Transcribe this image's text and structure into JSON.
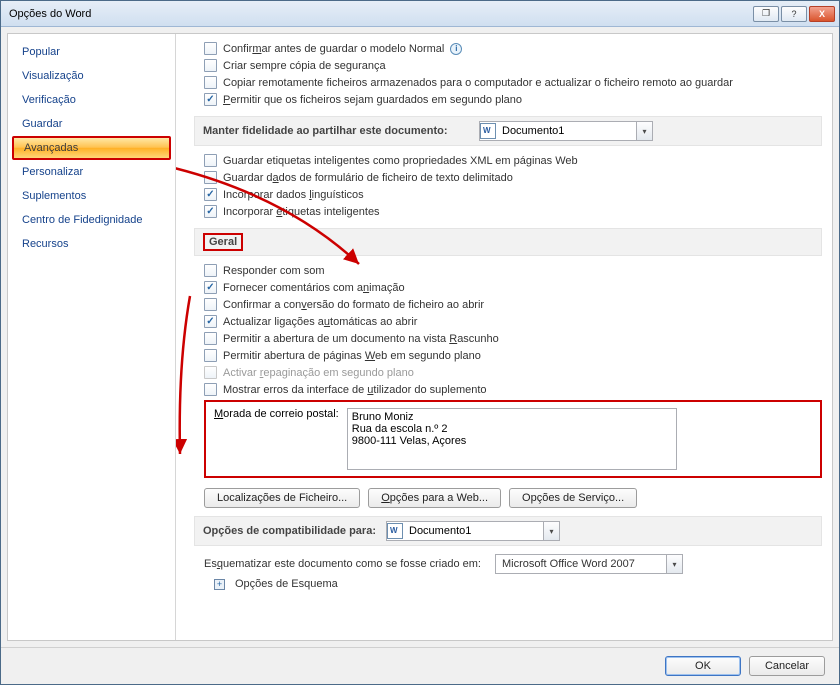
{
  "window": {
    "title": "Opções do Word"
  },
  "titlebar_buttons": {
    "restore": "❐",
    "help": "?",
    "close": "X"
  },
  "sidebar": {
    "items": [
      {
        "label": "Popular"
      },
      {
        "label": "Visualização"
      },
      {
        "label": "Verificação"
      },
      {
        "label": "Guardar"
      },
      {
        "label": "Avançadas",
        "selected": true
      },
      {
        "label": "Personalizar"
      },
      {
        "label": "Suplementos"
      },
      {
        "label": "Centro de Fidedignidade"
      },
      {
        "label": "Recursos"
      }
    ]
  },
  "section_top": {
    "confirm_normal_pre": "Confir",
    "confirm_normal_u": "m",
    "confirm_normal_post": "ar antes de guardar o modelo Normal",
    "backup_copy": "Criar sempre cópia de segurança",
    "remote_copy": "Copiar remotamente ficheiros armazenados para o computador e actualizar o ficheiro remoto ao guardar",
    "background_save_u": "P",
    "background_save_post": "ermitir que os ficheiros sejam guardados em segundo plano"
  },
  "share_header": {
    "label": "Manter fidelidade ao partilhar este documento:",
    "doc": "Documento1"
  },
  "share_checks": {
    "smart_tags_xml": "Guardar etiquetas inteligentes como propriedades XML em páginas Web",
    "form_data_pre": "Guardar d",
    "form_data_u": "a",
    "form_data_post": "dos de formulário de ficheiro de texto delimitado",
    "embed_ling_pre": "Incorporar dados ",
    "embed_ling_u": "l",
    "embed_ling_post": "inguísticos",
    "embed_smart_pre": "Incorporar ",
    "embed_smart_u": "e",
    "embed_smart_post": "tiquetas inteligentes"
  },
  "general": {
    "header": "Geral",
    "sound": "Responder com som",
    "anim_pre": "Fornecer comentários com a",
    "anim_u": "n",
    "anim_post": "imação",
    "confirm_conv_pre": "Confirmar a con",
    "confirm_conv_u": "v",
    "confirm_conv_post": "ersão do formato de ficheiro ao abrir",
    "auto_links_pre": "Actualizar ligações a",
    "auto_links_u": "u",
    "auto_links_post": "tomáticas ao abrir",
    "draft_view_pre": "Permitir a abertura de um documento na vista ",
    "draft_view_u": "R",
    "draft_view_post": "ascunho",
    "bg_web_pre": "Permitir abertura de páginas ",
    "bg_web_u": "W",
    "bg_web_post": "eb em segundo plano",
    "bg_repag_pre": "Activar ",
    "bg_repag_u": "r",
    "bg_repag_post": "epaginação em segundo plano",
    "addin_errors_pre": "Mostrar erros da interface de ",
    "addin_errors_u": "u",
    "addin_errors_post": "tilizador do suplemento",
    "address_label_u": "M",
    "address_label_post": "orada de correio postal:",
    "address_value": "Bruno Moniz\nRua da escola n.º 2\n9800-111 Velas, Açores",
    "btn_file_loc": "Localizações de Ficheiro...",
    "btn_web_opts_u": "O",
    "btn_web_opts_post": "pções para a Web...",
    "btn_service_opts": "Opções de Serviço..."
  },
  "compat": {
    "header": "Opções de compatibilidade para:",
    "doc": "Documento1",
    "layout_label_pre": "Es",
    "layout_label_u": "q",
    "layout_label_post": "uematizar este documento como se fosse criado em:",
    "layout_value": "Microsoft Office Word 2007",
    "expand": "Opções de Esquema"
  },
  "footer": {
    "ok": "OK",
    "cancel": "Cancelar"
  }
}
